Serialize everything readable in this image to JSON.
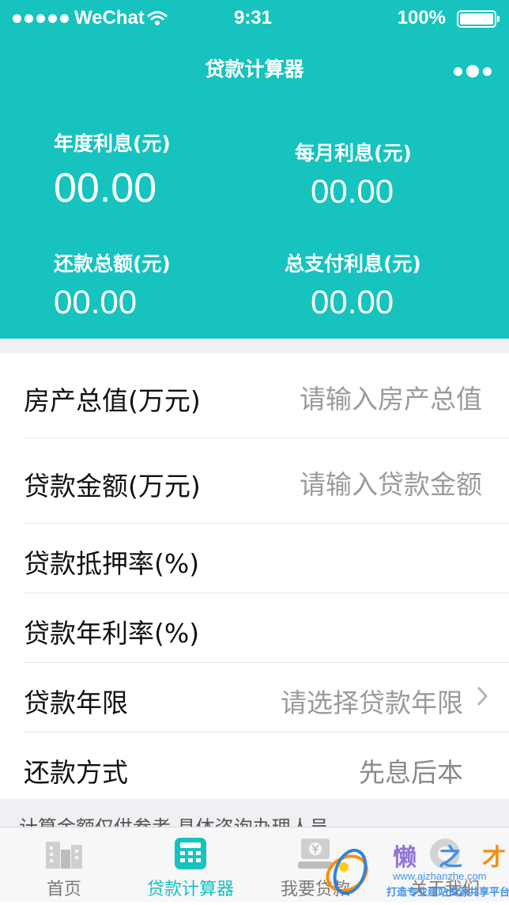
{
  "status_bar": {
    "carrier": "WeChat",
    "time": "9:31",
    "battery": "100%"
  },
  "nav": {
    "title": "贷款计算器"
  },
  "stats": {
    "annual_interest": {
      "label": "年度利息(元)",
      "value": "00.00"
    },
    "monthly_interest": {
      "label": "每月利息(元)",
      "value": "00.00"
    },
    "total_repayment": {
      "label": "还款总额(元)",
      "value": "00.00"
    },
    "total_interest": {
      "label": "总支付利息(元)",
      "value": "00.00"
    }
  },
  "form": {
    "property_value": {
      "label": "房产总值(万元)",
      "placeholder": "请输入房产总值"
    },
    "loan_amount": {
      "label": "贷款金额(万元)",
      "placeholder": "请输入贷款金额"
    },
    "mortgage_rate": {
      "label": "贷款抵押率(%)",
      "value": ""
    },
    "annual_rate": {
      "label": "贷款年利率(%)",
      "value": ""
    },
    "loan_term": {
      "label": "贷款年限",
      "placeholder": "请选择贷款年限"
    },
    "repayment_method": {
      "label": "还款方式",
      "value": "先息后本"
    }
  },
  "disclaimer": "计算金额仅供参考,具体咨询办理人员",
  "tabbar": {
    "items": [
      {
        "label": "首页",
        "icon": "home-building-icon",
        "active": false
      },
      {
        "label": "贷款计算器",
        "icon": "calculator-icon",
        "active": true
      },
      {
        "label": "我要贷款",
        "icon": "loan-yen-icon",
        "active": false
      },
      {
        "label": "关于我们",
        "icon": "about-icon",
        "active": false
      }
    ]
  },
  "watermark": {
    "brand": "懒之才",
    "url": "www.aizhanzhe.com",
    "slogan": "打造专业建站资源共享平台"
  },
  "colors": {
    "accent": "#16c3bf",
    "background": "#efeff4",
    "tab_inactive": "#7a7a7a"
  }
}
